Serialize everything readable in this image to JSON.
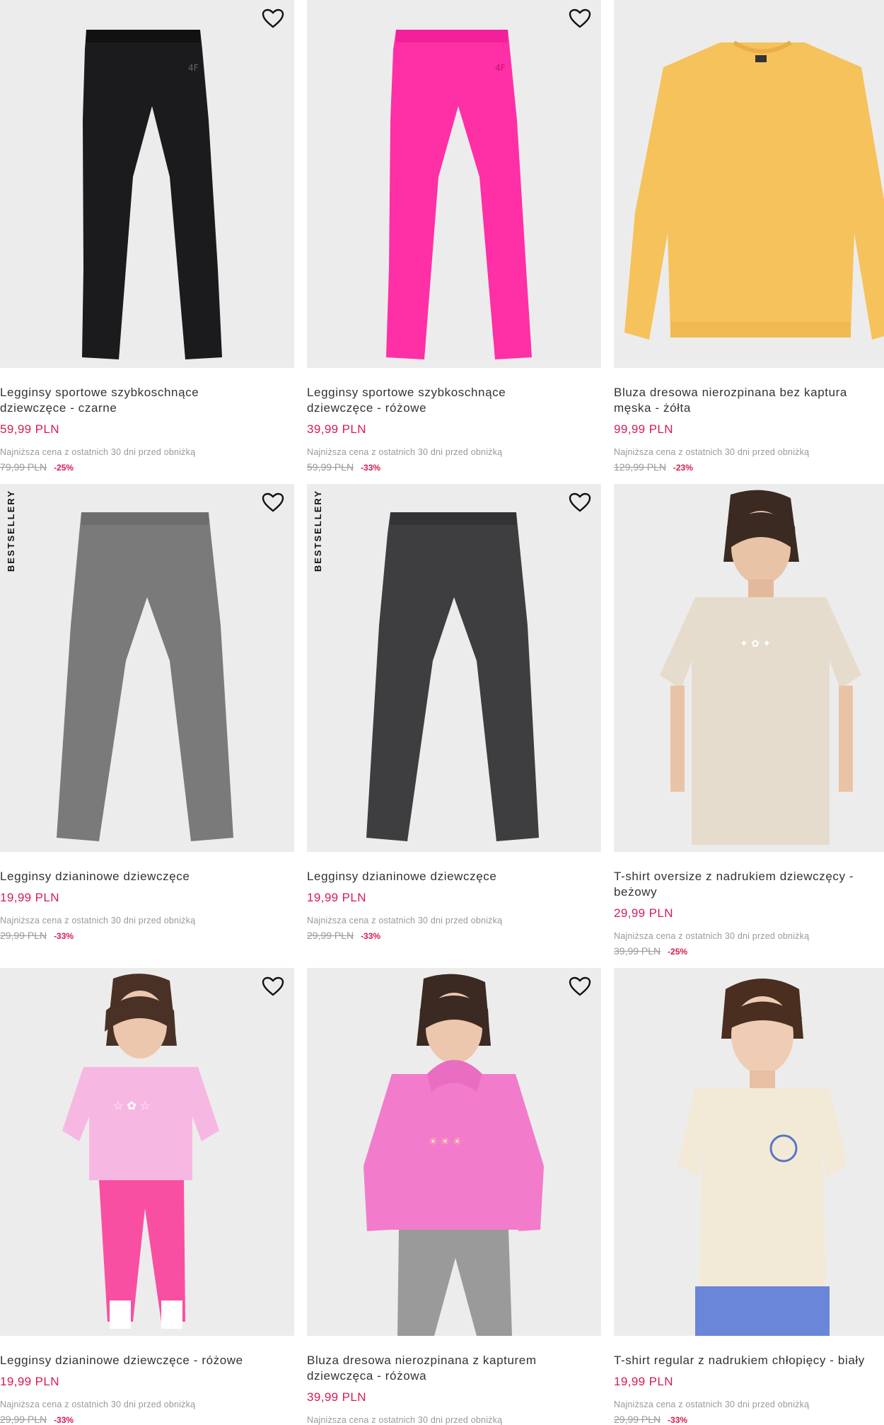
{
  "products": [
    {
      "name": "Legginsy sportowe szybkoschnące\ndziewczęce - czarne",
      "price": "59,99 PLN",
      "lowest_label": "Najniższa cena z ostatnich 30 dni przed obniżką",
      "old_price": "79,99 PLN",
      "discount": "-25%",
      "badge": "",
      "image": "black-leggings",
      "color": "#1b1b1e"
    },
    {
      "name": "Legginsy sportowe szybkoschnące\ndziewczęce - różowe",
      "price": "39,99 PLN",
      "lowest_label": "Najniższa cena z ostatnich 30 dni przed obniżką",
      "old_price": "59,99 PLN",
      "discount": "-33%",
      "badge": "",
      "image": "pink-leggings",
      "color": "#ff2fa6"
    },
    {
      "name": "Bluza dresowa nierozpinana bez kaptura\nmęska - żółta",
      "price": "99,99 PLN",
      "lowest_label": "Najniższa cena z ostatnich 30 dni przed obniżką",
      "old_price": "129,99 PLN",
      "discount": "-23%",
      "badge": "",
      "image": "yellow-sweatshirt",
      "color": "#f6c25c"
    },
    {
      "name": "Legginsy dzianinowe dziewczęce",
      "price": "19,99 PLN",
      "lowest_label": "Najniższa cena z ostatnich 30 dni przed obniżką",
      "old_price": "29,99 PLN",
      "discount": "-33%",
      "badge": "BESTSELLERY",
      "image": "grey-leggings",
      "color": "#7a7a7a"
    },
    {
      "name": "Legginsy dzianinowe dziewczęce",
      "price": "19,99 PLN",
      "lowest_label": "Najniższa cena z ostatnich 30 dni przed obniżką",
      "old_price": "29,99 PLN",
      "discount": "-33%",
      "badge": "BESTSELLERY",
      "image": "darkgrey-leggings",
      "color": "#3e3e40"
    },
    {
      "name": "T-shirt oversize z nadrukiem dziewczęcy -\nbeżowy",
      "price": "29,99 PLN",
      "lowest_label": "Najniższa cena z ostatnich 30 dni przed obniżką",
      "old_price": "39,99 PLN",
      "discount": "-25%",
      "badge": "",
      "image": "beige-tshirt-model",
      "color": "#e6dccd"
    },
    {
      "name": "Legginsy dzianinowe dziewczęce - różowe",
      "price": "19,99 PLN",
      "lowest_label": "Najniższa cena z ostatnich 30 dni przed obniżką",
      "old_price": "29,99 PLN",
      "discount": "-33%",
      "badge": "",
      "image": "pink-leggings-model",
      "color": "#f94fa2"
    },
    {
      "name": "Bluza dresowa nierozpinana z kapturem\ndziewczęca - różowa",
      "price": "39,99 PLN",
      "lowest_label": "Najniższa cena z ostatnich 30 dni przed obniżką",
      "old_price": "",
      "discount": "",
      "badge": "",
      "image": "pink-hoodie-model",
      "color": "#f27bcc"
    },
    {
      "name": "T-shirt regular z nadrukiem chłopięcy - biały",
      "price": "19,99 PLN",
      "lowest_label": "Najniższa cena z ostatnich 30 dni przed obniżką",
      "old_price": "29,99 PLN",
      "discount": "-33%",
      "badge": "",
      "image": "white-tshirt-model",
      "color": "#f2ead7"
    }
  ]
}
